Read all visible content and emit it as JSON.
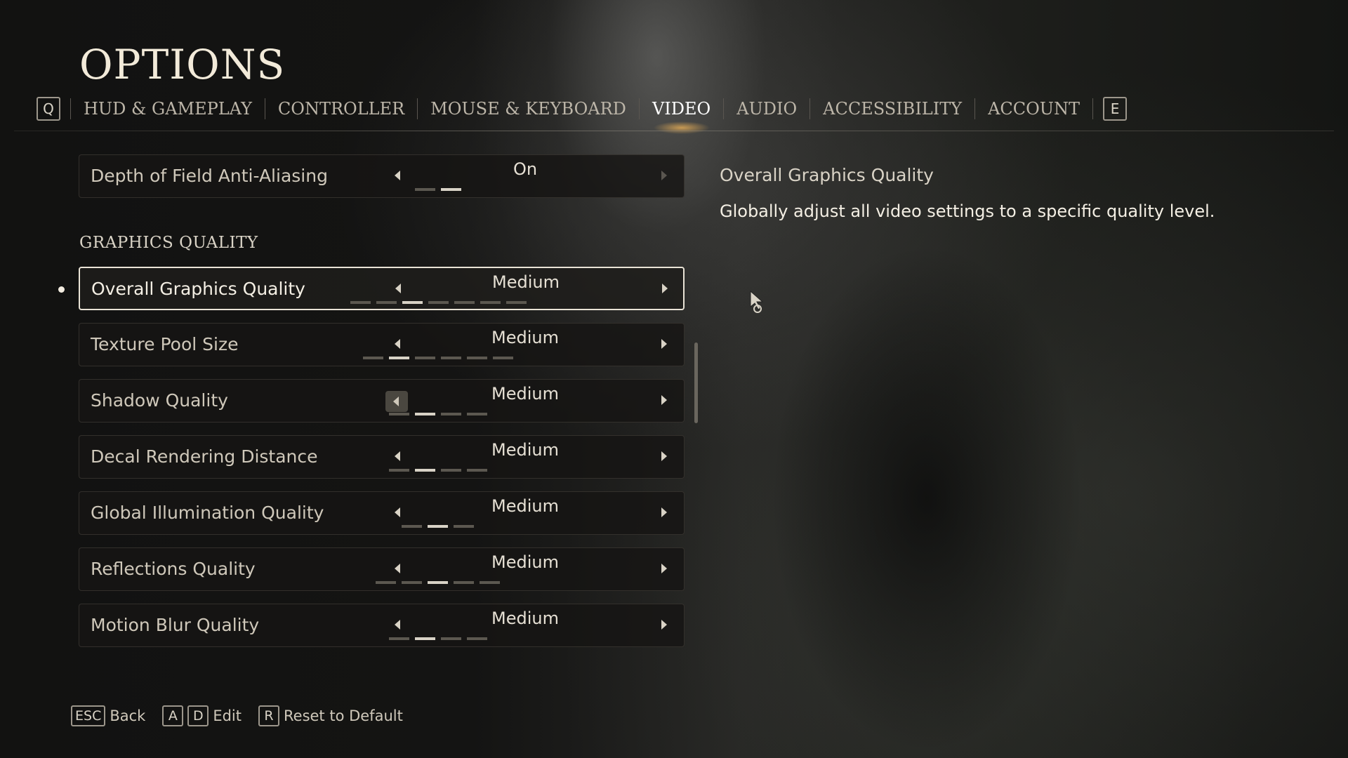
{
  "header": {
    "title": "OPTIONS",
    "left_key": "Q",
    "right_key": "E",
    "tabs": [
      {
        "label": "HUD & GAMEPLAY"
      },
      {
        "label": "CONTROLLER"
      },
      {
        "label": "MOUSE & KEYBOARD"
      },
      {
        "label": "VIDEO",
        "active": true
      },
      {
        "label": "AUDIO"
      },
      {
        "label": "ACCESSIBILITY"
      },
      {
        "label": "ACCOUNT"
      }
    ]
  },
  "settings": {
    "top_row": {
      "label": "Depth of Field Anti-Aliasing",
      "value": "On",
      "ticks": 2,
      "selected_tick": 2
    },
    "section_title": "GRAPHICS QUALITY",
    "rows": [
      {
        "label": "Overall Graphics Quality",
        "value": "Medium",
        "ticks": 7,
        "selected_tick": 3,
        "selected": true
      },
      {
        "label": "Texture Pool Size",
        "value": "Medium",
        "ticks": 6,
        "selected_tick": 2
      },
      {
        "label": "Shadow Quality",
        "value": "Medium",
        "ticks": 4,
        "selected_tick": 2,
        "left_arrow_highlighted": true
      },
      {
        "label": "Decal Rendering Distance",
        "value": "Medium",
        "ticks": 4,
        "selected_tick": 2
      },
      {
        "label": "Global Illumination Quality",
        "value": "Medium",
        "ticks": 3,
        "selected_tick": 2
      },
      {
        "label": "Reflections Quality",
        "value": "Medium",
        "ticks": 5,
        "selected_tick": 3
      },
      {
        "label": "Motion Blur Quality",
        "value": "Medium",
        "ticks": 4,
        "selected_tick": 2
      }
    ]
  },
  "description": {
    "title": "Overall Graphics Quality",
    "body": "Globally adjust all video settings to a specific quality level."
  },
  "footer": {
    "esc_key": "ESC",
    "back_label": "Back",
    "a_key": "A",
    "d_key": "D",
    "edit_label": "Edit",
    "r_key": "R",
    "reset_label": "Reset to Default"
  },
  "colors": {
    "accent": "#f2ead9",
    "tick_on": "#d8d2c6",
    "tick_off": "#5c5850"
  }
}
